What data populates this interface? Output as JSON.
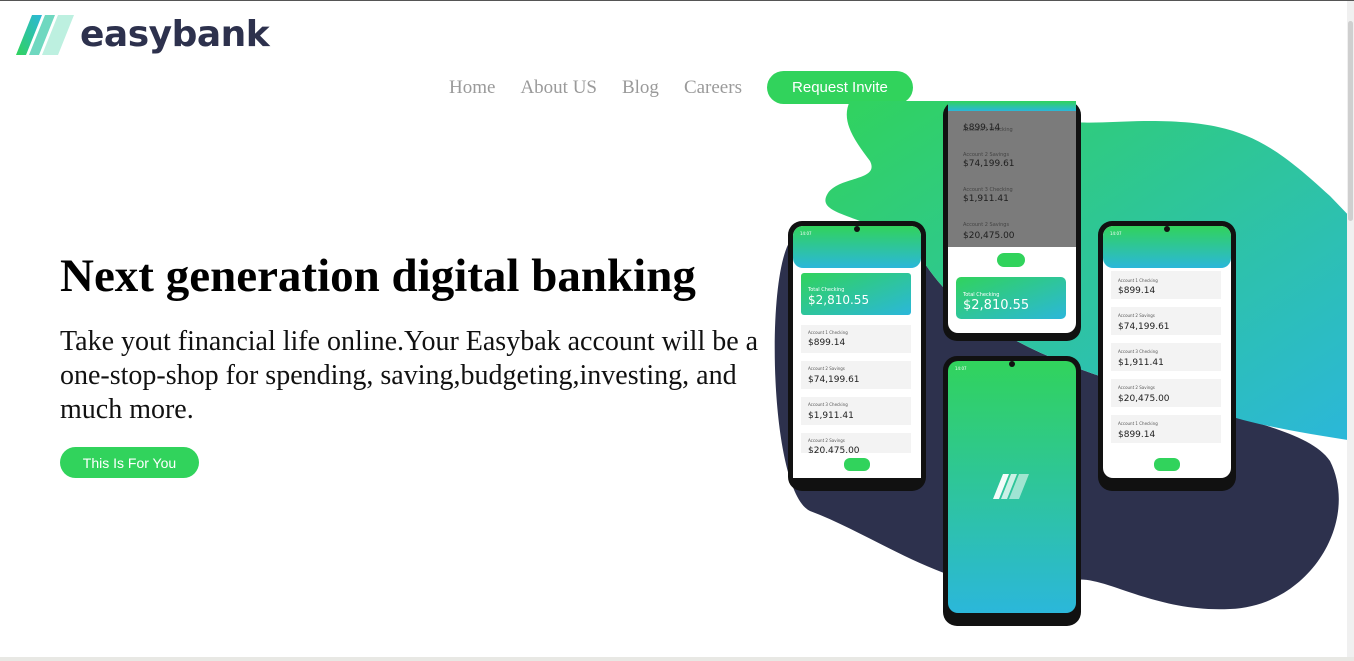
{
  "brand": {
    "name": "easybank"
  },
  "nav": {
    "links": [
      "Home",
      "About US",
      "Blog",
      "Careers"
    ],
    "cta": "Request Invite"
  },
  "hero": {
    "title": "Next generation digital banking",
    "text": "Take yout financial life online.Your Easybak account will be a one-stop-shop for spending, saving,budgeting,investing, and much more.",
    "button": "This Is For You"
  },
  "phones": {
    "total_label": "Total Checking",
    "total_value": "$2,810.55",
    "accounts": [
      {
        "label": "Account 1 Checking",
        "value": "$899.14"
      },
      {
        "label": "Account 2 Savings",
        "value": "$74,199.61"
      },
      {
        "label": "Account 3 Checking",
        "value": "$1,911.41"
      },
      {
        "label": "Account 2 Savings",
        "value": "$20,475.00"
      },
      {
        "label": "Account 1 Checking",
        "value": "$899.14"
      }
    ],
    "status_time": "14:07"
  },
  "colors": {
    "accent": "#31d35c",
    "brand_dark": "#2d314d",
    "gradient_start": "#31d35c",
    "gradient_end": "#2bb7da"
  }
}
